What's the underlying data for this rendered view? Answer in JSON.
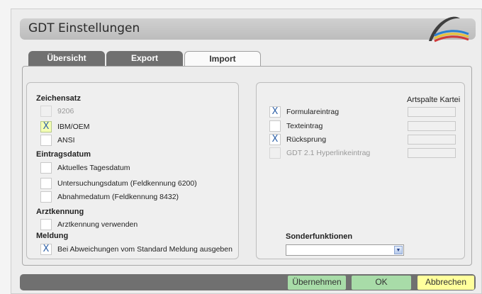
{
  "window": {
    "title": "GDT Einstellungen"
  },
  "tabs": [
    {
      "label": "Übersicht",
      "active": false
    },
    {
      "label": "Export",
      "active": false
    },
    {
      "label": "Import",
      "active": true
    }
  ],
  "left": {
    "zeichensatz": {
      "heading": "Zeichensatz",
      "options": [
        {
          "label": "9206",
          "checked": false,
          "mark": "",
          "enabled": false
        },
        {
          "label": "IBM/OEM",
          "checked": true,
          "mark": "X",
          "enabled": true
        },
        {
          "label": "ANSI",
          "checked": false,
          "mark": "",
          "enabled": true
        }
      ]
    },
    "eintragsdatum": {
      "heading": "Eintragsdatum",
      "options": [
        {
          "label": "Aktuelles Tagesdatum",
          "checked": false,
          "mark": ""
        },
        {
          "label": "Untersuchungsdatum (Feldkennung 6200)",
          "checked": false,
          "mark": ""
        },
        {
          "label": "Abnahmedatum (Feldkennung 8432)",
          "checked": false,
          "mark": ""
        }
      ]
    },
    "arztkennung": {
      "heading": "Arztkennung",
      "option": {
        "label": "Arztkennung verwenden",
        "checked": false,
        "mark": ""
      }
    },
    "meldung": {
      "heading": "Meldung",
      "option": {
        "label": "Bei Abweichungen vom Standard Meldung ausgeben",
        "checked": true,
        "mark": "X"
      }
    }
  },
  "right": {
    "column_header": "Artspalte Kartei",
    "entries": [
      {
        "label": "Formulareintrag",
        "checked": true,
        "mark": "X",
        "enabled": true,
        "artspalte": ""
      },
      {
        "label": "Texteintrag",
        "checked": false,
        "mark": "",
        "enabled": true,
        "artspalte": ""
      },
      {
        "label": "Rücksprung",
        "checked": true,
        "mark": "X",
        "enabled": true,
        "artspalte": ""
      },
      {
        "label": "GDT 2.1 Hyperlinkeintrag",
        "checked": false,
        "mark": "",
        "enabled": false,
        "artspalte": ""
      }
    ],
    "sonderfunktionen": {
      "heading": "Sonderfunktionen",
      "value": ""
    }
  },
  "buttons": {
    "uebernehmen": "Übernehmen",
    "ok": "OK",
    "abbrechen": "Abbrechen"
  },
  "colors": {
    "titlebar": "#c5c5c5",
    "tab_inactive": "#707070",
    "button_green": "#a8dca8",
    "button_yellow": "#ffff9c",
    "check_mark": "#3062a8"
  }
}
